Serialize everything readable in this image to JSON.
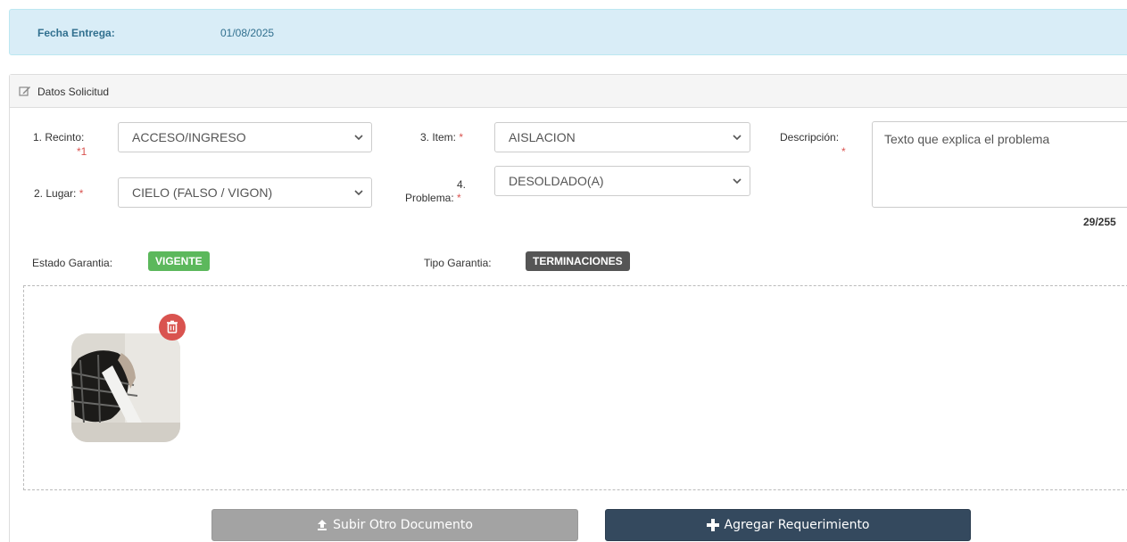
{
  "info": {
    "label": "Fecha Entrega:",
    "value": "01/08/2025"
  },
  "panel": {
    "title": "Datos Solicitud"
  },
  "fields": {
    "recinto": {
      "label": "1. Recinto:",
      "req": "*1",
      "value": "ACCESO/INGRESO"
    },
    "lugar": {
      "label": "2. Lugar:",
      "req": "*",
      "value": "CIELO (FALSO / VIGON)"
    },
    "item": {
      "label": "3. Item:",
      "req": "*",
      "value": "AISLACION"
    },
    "problema": {
      "label_a": "4.",
      "label_b": "Problema:",
      "req": "*",
      "value": "DESOLDADO(A)"
    },
    "descripcion": {
      "label": "Descripción:",
      "req": "*",
      "value": "Texto que explica el problema",
      "counter": "29/255"
    }
  },
  "garantia": {
    "estado_label": "Estado Garantia:",
    "estado_value": "VIGENTE",
    "tipo_label": "Tipo Garantia:",
    "tipo_value": "TERMINACIONES"
  },
  "buttons": {
    "upload": "Subir Otro Documento",
    "add": "Agregar Requerimiento"
  },
  "colors": {
    "info_bg": "#d9edf7",
    "badge_green": "#5cb85c",
    "badge_dark": "#555555",
    "primary": "#34495e",
    "danger": "#d9534f"
  },
  "icons": {
    "panel": "edit-icon",
    "delete": "trash-icon",
    "upload": "upload-icon",
    "add": "plus-icon",
    "select": "chevron-down-icon"
  }
}
